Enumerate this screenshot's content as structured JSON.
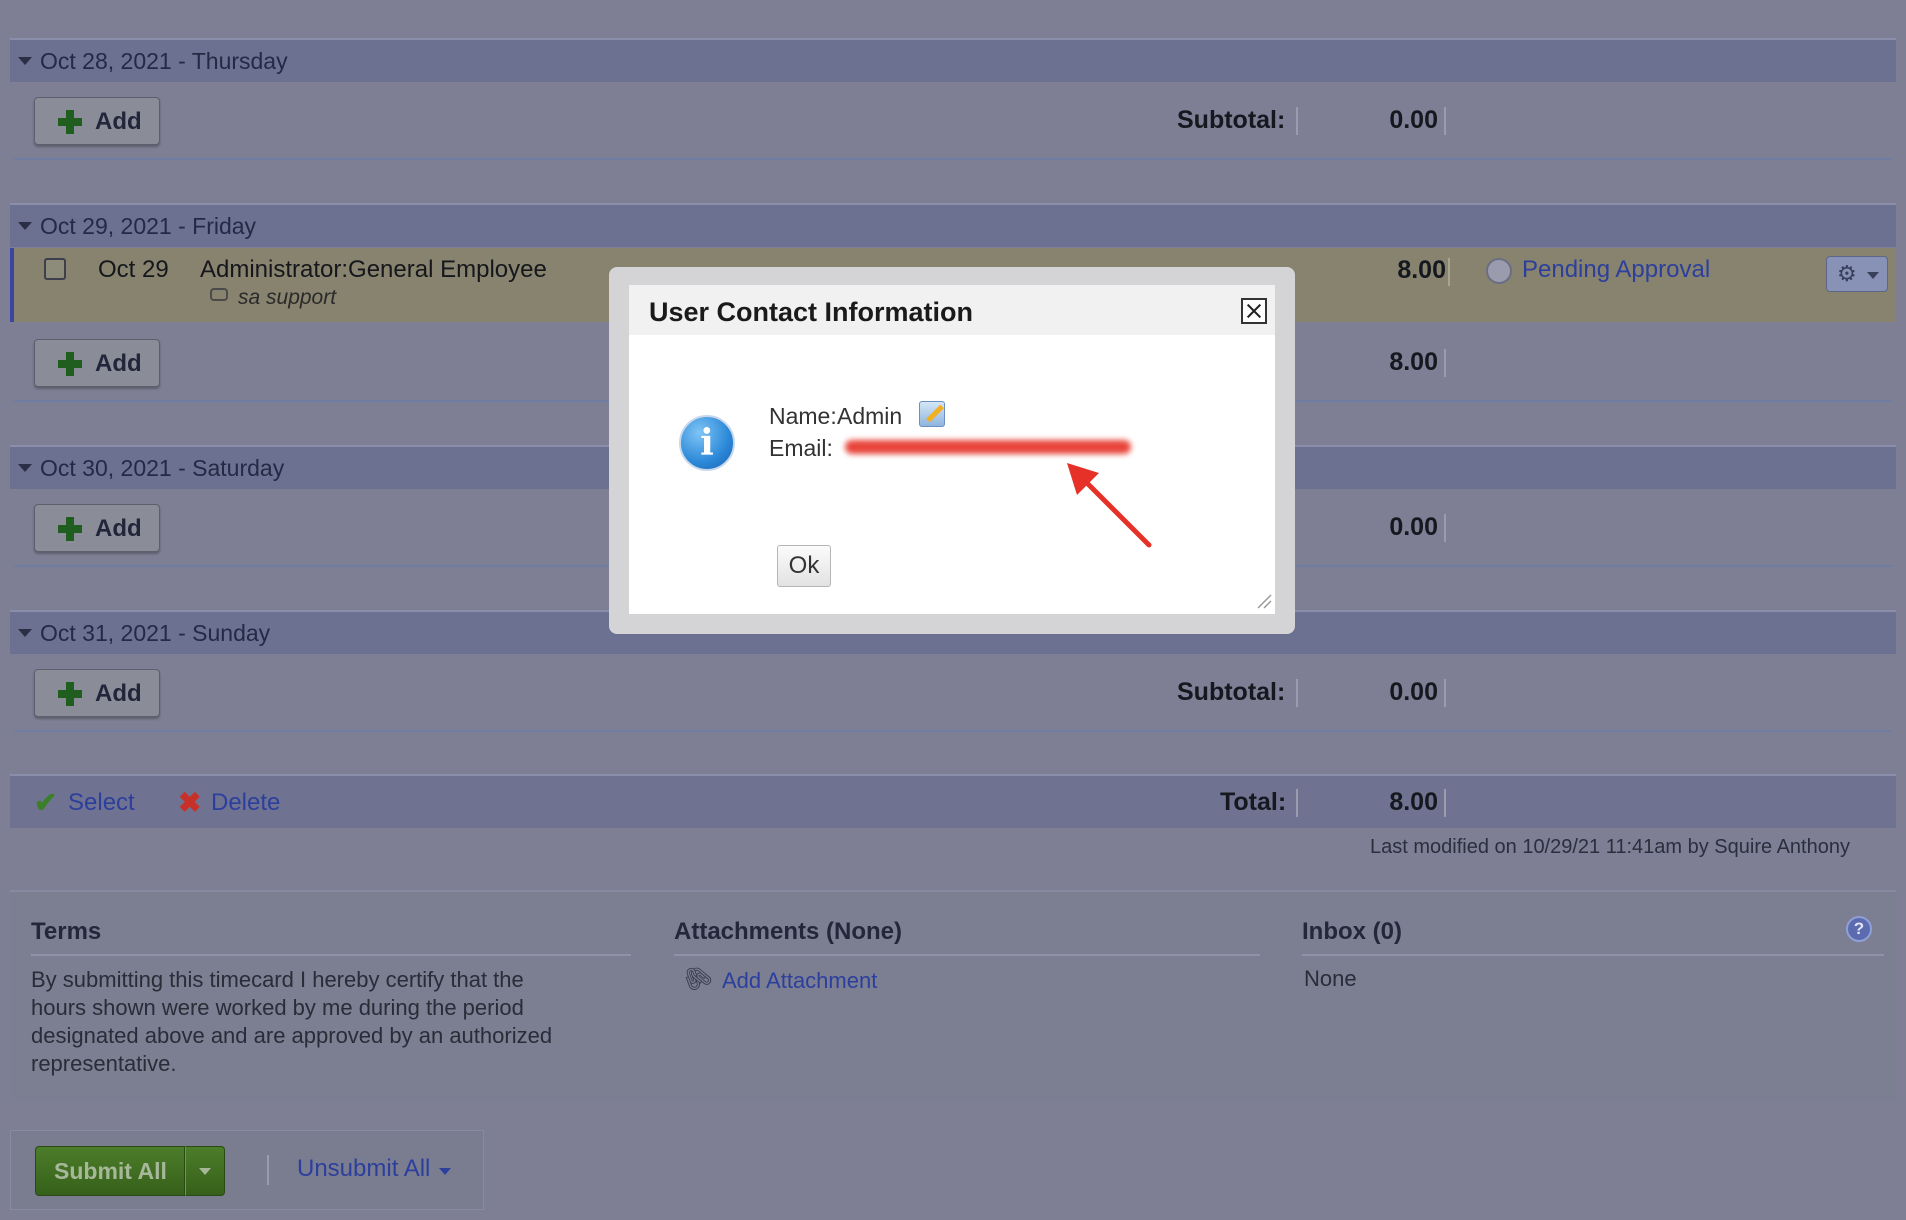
{
  "days": [
    {
      "title": "Oct 28, 2021 - Thursday",
      "add_label": "Add",
      "subtotal_label": "Subtotal:",
      "subtotal": "0.00"
    },
    {
      "title": "Oct 29, 2021 - Friday",
      "add_label": "Add",
      "subtotal": "8.00"
    },
    {
      "title": "Oct 30, 2021 - Saturday",
      "add_label": "Add",
      "subtotal": "0.00"
    },
    {
      "title": "Oct 31, 2021 - Sunday",
      "add_label": "Add",
      "subtotal_label": "Subtotal:",
      "subtotal": "0.00"
    }
  ],
  "entry": {
    "date": "Oct 29",
    "description": "Administrator:General Employee",
    "comment": "sa support",
    "hours": "8.00",
    "status": "Pending Approval"
  },
  "footer": {
    "select_label": "Select",
    "delete_label": "Delete",
    "total_label": "Total:",
    "total": "8.00",
    "last_modified": "Last modified on 10/29/21 11:41am by Squire Anthony"
  },
  "terms": {
    "heading": "Terms",
    "lines": [
      "By submitting this timecard I hereby certify that the",
      "hours shown were worked by me during the period",
      "designated above and are approved by an authorized",
      "representative."
    ]
  },
  "attachments": {
    "heading": "Attachments (None)",
    "add_label": "Add Attachment"
  },
  "inbox": {
    "heading": "Inbox (0)",
    "value": "None"
  },
  "actions": {
    "submit_label": "Submit All",
    "unsubmit_label": "Unsubmit All"
  },
  "modal": {
    "title": "User Contact Information",
    "name_label": "Name:",
    "name_value": "Admin",
    "email_label": "Email:",
    "ok_label": "Ok"
  },
  "colors": {
    "accent_link": "#2c3f9c",
    "submit_green": "#3f6b1f",
    "annotation_arrow": "#e53127"
  }
}
